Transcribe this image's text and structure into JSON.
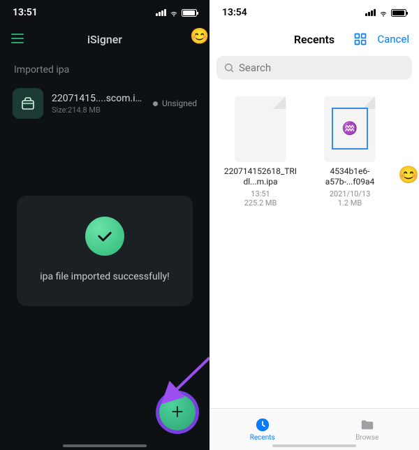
{
  "left": {
    "time": "13:51",
    "app_title": "iSigner",
    "section_label": "Imported ipa",
    "file": {
      "name": "22071415....scom.ipa",
      "size": "Size:214.8 MB",
      "status": "Unsigned"
    },
    "toast": "ipa file imported successfully!"
  },
  "right": {
    "time": "13:54",
    "nav_title": "Recents",
    "cancel": "Cancel",
    "search_placeholder": "Search",
    "files": [
      {
        "name": "220714152618_TRIdl...m.ipa",
        "date": "13:51",
        "size": "225.2 MB"
      },
      {
        "name": "4534b1e6-a57b-...f09a4",
        "date": "2021/10/13",
        "size": "1.2 MB"
      }
    ],
    "tabs": {
      "recents": "Recents",
      "browse": "Browse"
    }
  }
}
